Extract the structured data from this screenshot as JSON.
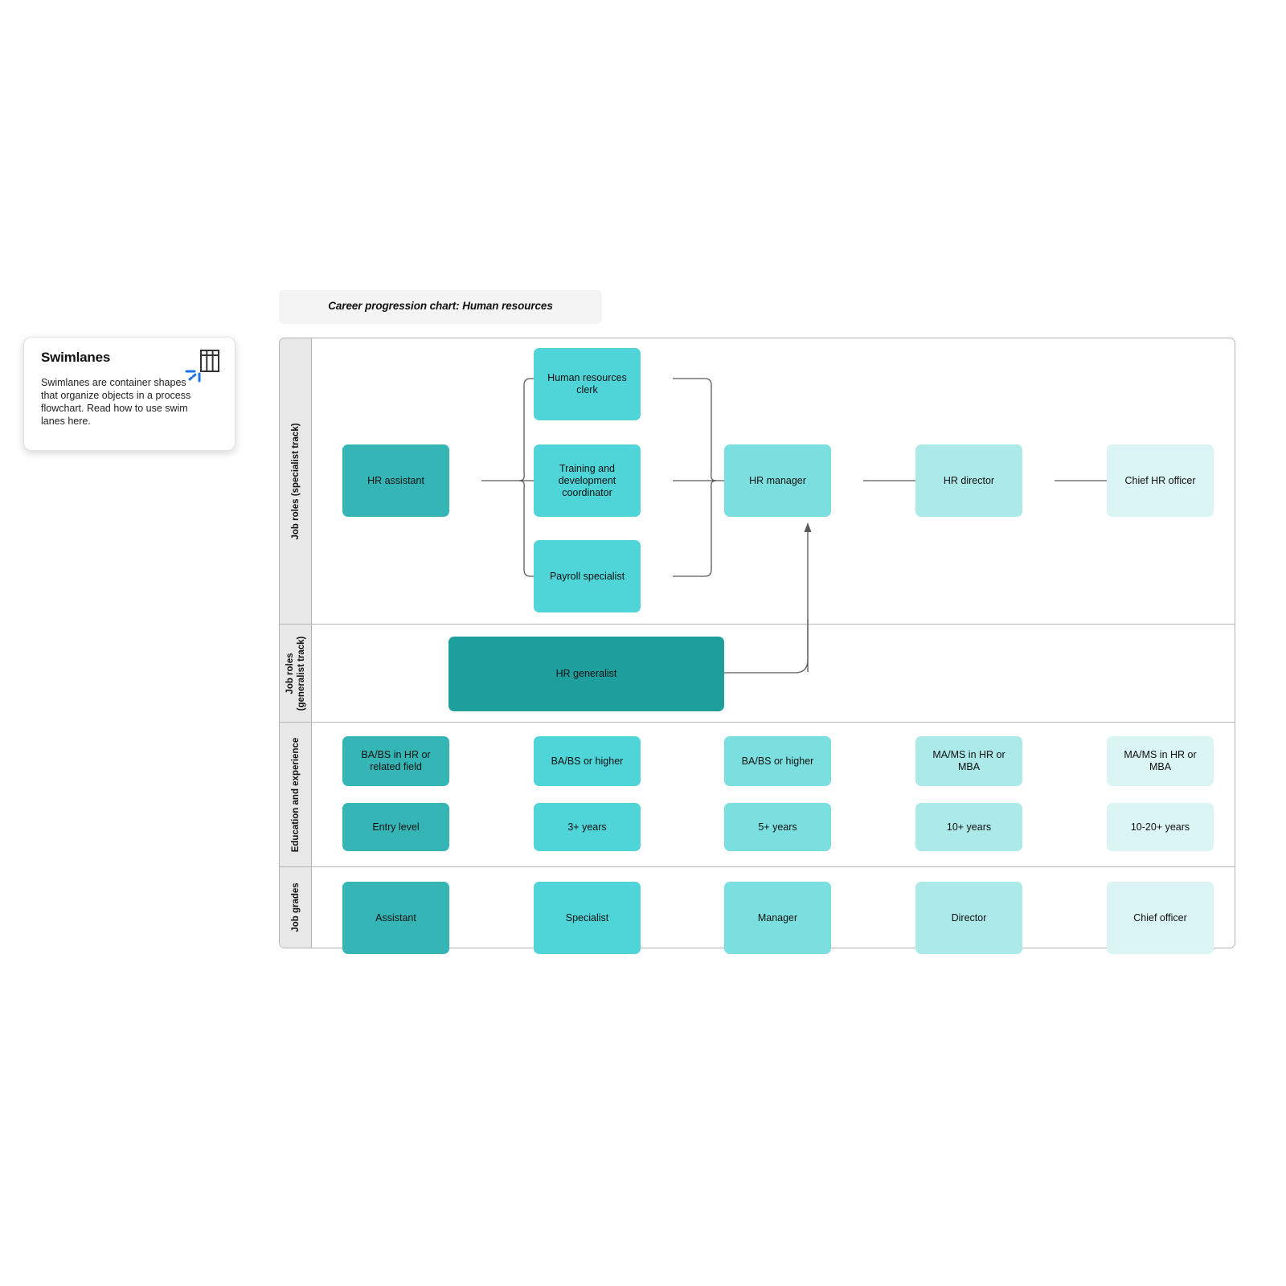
{
  "info_card": {
    "title": "Swimlanes",
    "body": "Swimlanes are container shapes that organize objects in a process flowchart. Read how to use swim lanes here.",
    "icon": "swimlane-table-icon"
  },
  "chart_title": "Career progression chart: Human resources",
  "palette": {
    "col1": "#35B5B5",
    "col2": "#4FD4D8",
    "col3": "#7CDFDF",
    "col4": "#ACE9E9",
    "col5": "#DBF4F4",
    "generalist": "#1F9E9E",
    "lane_header_bg": "#E8E8E8",
    "lane_border": "#B4B4B4",
    "connector": "#595959",
    "title_chip_bg": "#F4F4F4"
  },
  "lanes": [
    {
      "label": "Job roles (specialist track)"
    },
    {
      "label": "Job roles\n(generalist track)"
    },
    {
      "label": "Education and experience"
    },
    {
      "label": "Job grades"
    }
  ],
  "nodes": {
    "hr_assistant": "HR assistant",
    "hr_clerk": "Human resources clerk",
    "training_coordinator": "Training and development coordinator",
    "payroll_specialist": "Payroll specialist",
    "hr_manager": "HR manager",
    "hr_director": "HR director",
    "chief_hr_officer": "Chief HR officer",
    "hr_generalist": "HR generalist",
    "edu_1": "BA/BS in HR or related field",
    "edu_2": "BA/BS or higher",
    "edu_3": "BA/BS or higher",
    "edu_4": "MA/MS in HR or MBA",
    "edu_5": "MA/MS in HR or MBA",
    "exp_1": "Entry level",
    "exp_2": "3+ years",
    "exp_3": "5+ years",
    "exp_4": "10+ years",
    "exp_5": "10-20+ years",
    "grade_1": "Assistant",
    "grade_2": "Specialist",
    "grade_3": "Manager",
    "grade_4": "Director",
    "grade_5": "Chief officer"
  }
}
